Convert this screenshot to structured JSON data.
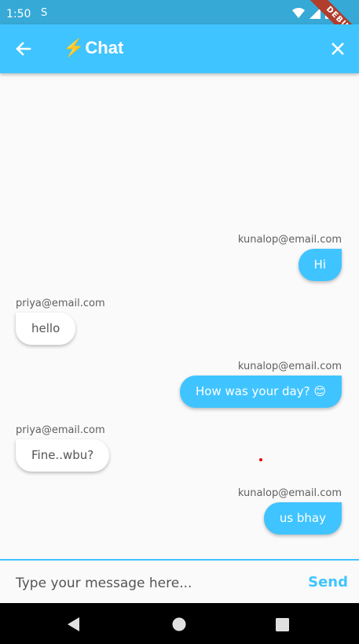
{
  "status_bar": {
    "time": "1:50",
    "sim_icon": "S",
    "debug": "DEBUG"
  },
  "app_bar": {
    "bolt": "⚡",
    "title": "Chat"
  },
  "messages": [
    {
      "sender": "kunalop@email.com",
      "text": "Hi",
      "side": "right"
    },
    {
      "sender": "priya@email.com",
      "text": "hello",
      "side": "left"
    },
    {
      "sender": "kunalop@email.com",
      "text": "How was your day? 😊",
      "side": "right"
    },
    {
      "sender": "priya@email.com",
      "text": "Fine..wbu?",
      "side": "left"
    },
    {
      "sender": "kunalop@email.com",
      "text": "us bhay",
      "side": "right"
    }
  ],
  "composer": {
    "placeholder": "Type your message here...",
    "send_label": "Send"
  },
  "colors": {
    "accent": "#40c4ff",
    "status_bar": "#36a9d6"
  }
}
